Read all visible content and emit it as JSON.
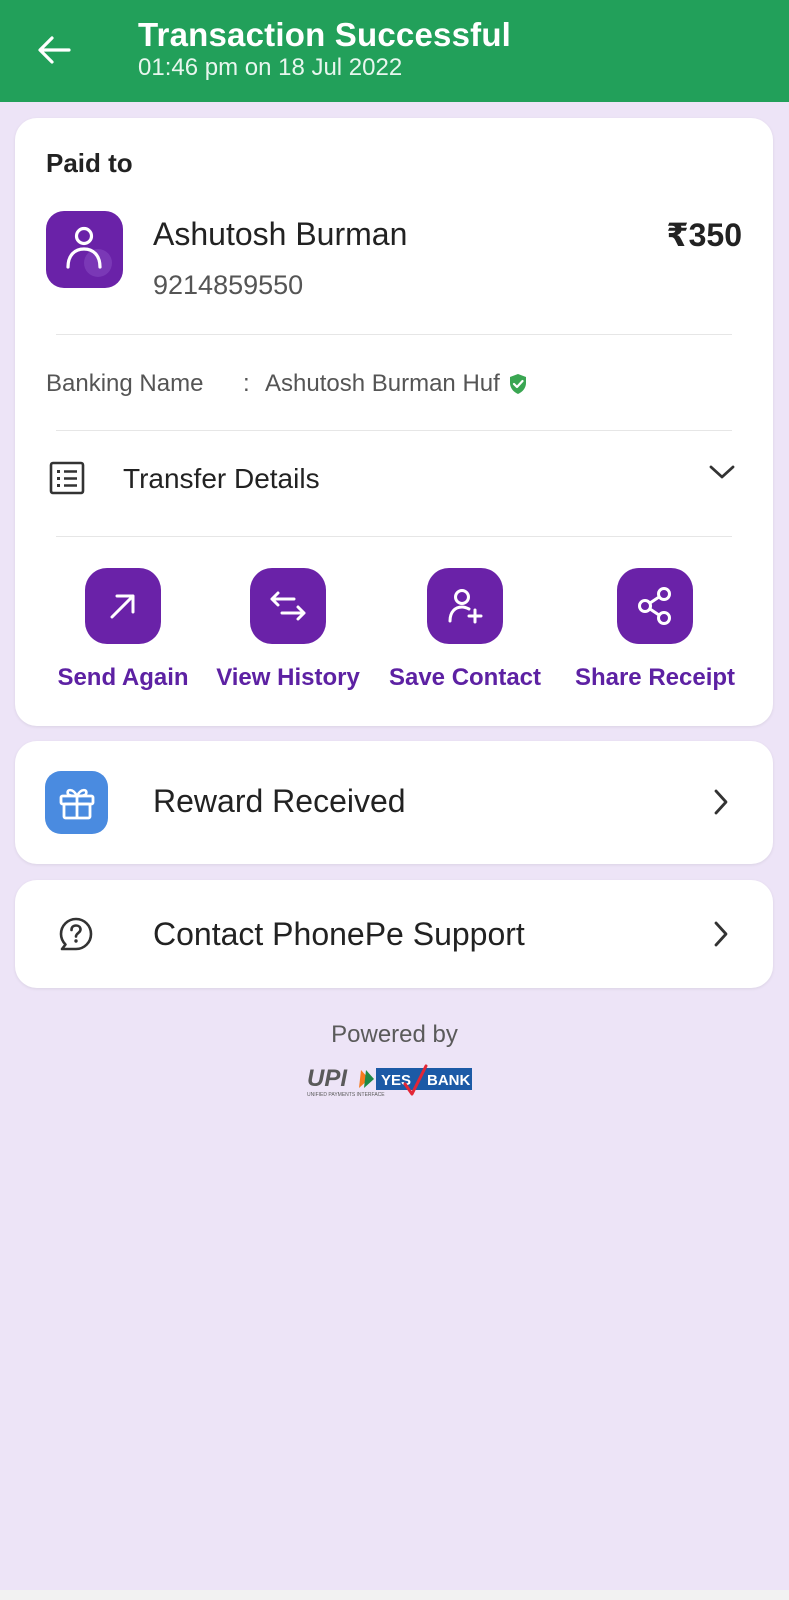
{
  "header": {
    "title": "Transaction Successful",
    "subtitle": "01:46 pm on 18 Jul 2022"
  },
  "payment": {
    "paid_to_label": "Paid to",
    "payee_name": "Ashutosh Burman",
    "payee_phone": "9214859550",
    "amount": "₹350",
    "banking_name_label": "Banking Name",
    "banking_name_separator": ":",
    "banking_name_value": "Ashutosh Burman Huf",
    "transfer_details_label": "Transfer Details"
  },
  "actions": [
    {
      "label": "Send Again",
      "icon": "arrow-up-right-icon"
    },
    {
      "label": "View History",
      "icon": "swap-arrows-icon"
    },
    {
      "label": "Save Contact",
      "icon": "add-contact-icon"
    },
    {
      "label": "Share Receipt",
      "icon": "share-icon"
    }
  ],
  "reward": {
    "label": "Reward Received",
    "icon": "gift-icon"
  },
  "support": {
    "label": "Contact PhonePe Support",
    "icon": "help-icon"
  },
  "footer": {
    "powered_by": "Powered by",
    "upi_text": "UPI",
    "upi_tagline": "UNIFIED PAYMENTS INTERFACE",
    "bank_text_1": "YES",
    "bank_text_2": "BANK"
  },
  "colors": {
    "header_green": "#22a05a",
    "brand_purple": "#6a22a8",
    "action_label_purple": "#5d21a3",
    "background_lavender": "#ede4f7",
    "verified_green": "#3aa652",
    "gift_blue": "#4a8be0"
  }
}
